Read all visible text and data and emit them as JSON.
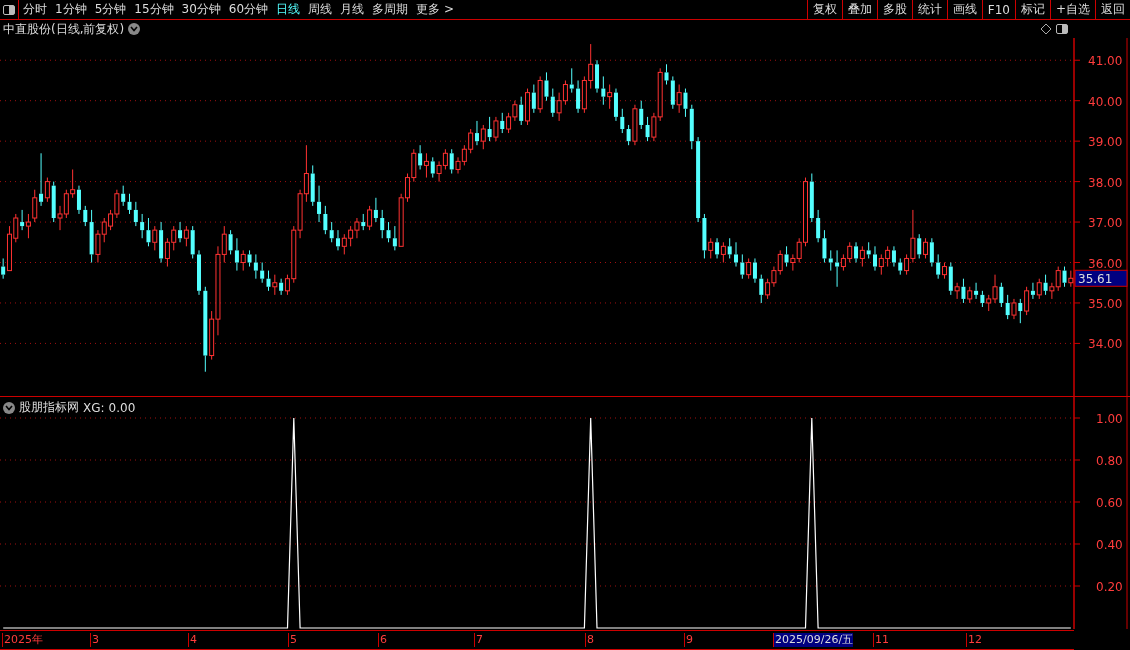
{
  "toolbar": {
    "periods": [
      {
        "label": "分时",
        "selected": false
      },
      {
        "label": "1分钟",
        "selected": false
      },
      {
        "label": "5分钟",
        "selected": false
      },
      {
        "label": "15分钟",
        "selected": false
      },
      {
        "label": "30分钟",
        "selected": false
      },
      {
        "label": "60分钟",
        "selected": false
      },
      {
        "label": "日线",
        "selected": true
      },
      {
        "label": "周线",
        "selected": false
      },
      {
        "label": "月线",
        "selected": false
      },
      {
        "label": "多周期",
        "selected": false
      },
      {
        "label": "更多 >",
        "selected": false
      }
    ],
    "buttons": [
      "复权",
      "叠加",
      "多股",
      "统计",
      "画线",
      "F10",
      "标记",
      "+自选",
      "返回"
    ]
  },
  "main_chart": {
    "title": "中直股份(日线,前复权)",
    "current_price": "35.61",
    "chart_data": {
      "type": "candlestick",
      "grid": true,
      "ylim": [
        32.7,
        41.55
      ],
      "yticks": [
        {
          "value": 41,
          "label": "41.00"
        },
        {
          "value": 40,
          "label": "40.00"
        },
        {
          "value": 39,
          "label": "39.00"
        },
        {
          "value": 38,
          "label": "38.00"
        },
        {
          "value": 37,
          "label": "37.00"
        },
        {
          "value": 36,
          "label": "36.00"
        },
        {
          "value": 35,
          "label": "35.00"
        },
        {
          "value": 34,
          "label": "34.00"
        }
      ],
      "ohlc": [
        [
          35.9,
          36.1,
          35.6,
          35.7
        ],
        [
          35.8,
          36.9,
          35.8,
          36.7
        ],
        [
          36.6,
          37.2,
          36.5,
          37.1
        ],
        [
          37.0,
          37.3,
          36.8,
          36.9
        ],
        [
          36.9,
          37.2,
          36.6,
          37.0
        ],
        [
          37.1,
          37.8,
          37.0,
          37.6
        ],
        [
          37.7,
          38.7,
          37.4,
          37.5
        ],
        [
          37.6,
          38.1,
          37.5,
          38.0
        ],
        [
          37.9,
          38.0,
          37.0,
          37.1
        ],
        [
          37.1,
          37.4,
          36.8,
          37.2
        ],
        [
          37.2,
          37.8,
          37.1,
          37.7
        ],
        [
          37.7,
          38.3,
          37.6,
          37.8
        ],
        [
          37.8,
          37.9,
          37.2,
          37.3
        ],
        [
          37.3,
          37.4,
          36.9,
          37.0
        ],
        [
          37.0,
          37.3,
          36.0,
          36.2
        ],
        [
          36.2,
          36.8,
          36.0,
          36.7
        ],
        [
          36.7,
          37.1,
          36.5,
          37.0
        ],
        [
          36.9,
          37.3,
          36.8,
          37.2
        ],
        [
          37.2,
          37.8,
          37.1,
          37.7
        ],
        [
          37.7,
          37.9,
          37.4,
          37.5
        ],
        [
          37.5,
          37.7,
          37.2,
          37.3
        ],
        [
          37.3,
          37.5,
          36.9,
          37.0
        ],
        [
          37.0,
          37.2,
          36.6,
          36.8
        ],
        [
          36.8,
          37.1,
          36.4,
          36.5
        ],
        [
          36.5,
          36.9,
          36.3,
          36.8
        ],
        [
          36.8,
          37.0,
          36.0,
          36.1
        ],
        [
          36.1,
          36.6,
          35.9,
          36.5
        ],
        [
          36.5,
          36.9,
          36.3,
          36.8
        ],
        [
          36.8,
          37.0,
          36.5,
          36.6
        ],
        [
          36.6,
          36.9,
          36.4,
          36.8
        ],
        [
          36.8,
          36.9,
          36.1,
          36.2
        ],
        [
          36.2,
          36.3,
          35.2,
          35.3
        ],
        [
          35.3,
          35.4,
          33.3,
          33.7
        ],
        [
          33.7,
          34.8,
          33.6,
          34.6
        ],
        [
          34.6,
          36.4,
          34.2,
          36.2
        ],
        [
          36.2,
          36.9,
          36.0,
          36.7
        ],
        [
          36.7,
          36.8,
          36.2,
          36.3
        ],
        [
          36.3,
          36.6,
          35.8,
          36.0
        ],
        [
          36.0,
          36.3,
          35.8,
          36.2
        ],
        [
          36.2,
          36.3,
          35.9,
          36.0
        ],
        [
          36.0,
          36.2,
          35.6,
          35.8
        ],
        [
          35.8,
          36.0,
          35.5,
          35.6
        ],
        [
          35.6,
          35.8,
          35.3,
          35.4
        ],
        [
          35.4,
          35.7,
          35.2,
          35.5
        ],
        [
          35.5,
          35.6,
          35.2,
          35.3
        ],
        [
          35.3,
          35.7,
          35.2,
          35.6
        ],
        [
          35.6,
          36.9,
          35.5,
          36.8
        ],
        [
          36.8,
          37.8,
          36.6,
          37.7
        ],
        [
          37.7,
          38.9,
          37.5,
          38.2
        ],
        [
          38.2,
          38.4,
          37.4,
          37.5
        ],
        [
          37.5,
          37.9,
          37.0,
          37.2
        ],
        [
          37.2,
          37.4,
          36.7,
          36.8
        ],
        [
          36.8,
          37.0,
          36.5,
          36.6
        ],
        [
          36.6,
          36.8,
          36.3,
          36.4
        ],
        [
          36.4,
          36.7,
          36.2,
          36.6
        ],
        [
          36.6,
          36.9,
          36.4,
          36.8
        ],
        [
          36.8,
          37.1,
          36.6,
          37.0
        ],
        [
          37.0,
          37.2,
          36.8,
          36.9
        ],
        [
          36.9,
          37.4,
          36.8,
          37.3
        ],
        [
          37.3,
          37.6,
          37.0,
          37.1
        ],
        [
          37.1,
          37.3,
          36.6,
          36.8
        ],
        [
          36.8,
          37.0,
          36.5,
          36.6
        ],
        [
          36.6,
          36.9,
          36.3,
          36.4
        ],
        [
          36.4,
          37.7,
          36.4,
          37.6
        ],
        [
          37.6,
          38.2,
          37.5,
          38.1
        ],
        [
          38.1,
          38.8,
          38.0,
          38.7
        ],
        [
          38.7,
          38.9,
          38.3,
          38.4
        ],
        [
          38.4,
          38.7,
          38.1,
          38.5
        ],
        [
          38.5,
          38.6,
          38.1,
          38.2
        ],
        [
          38.2,
          38.5,
          38.0,
          38.4
        ],
        [
          38.4,
          38.8,
          38.3,
          38.7
        ],
        [
          38.7,
          38.8,
          38.2,
          38.3
        ],
        [
          38.3,
          38.6,
          38.2,
          38.5
        ],
        [
          38.5,
          38.9,
          38.4,
          38.8
        ],
        [
          38.8,
          39.3,
          38.7,
          39.2
        ],
        [
          39.2,
          39.5,
          38.9,
          39.0
        ],
        [
          39.0,
          39.4,
          38.8,
          39.3
        ],
        [
          39.3,
          39.6,
          39.0,
          39.1
        ],
        [
          39.1,
          39.6,
          39.0,
          39.5
        ],
        [
          39.5,
          39.7,
          39.2,
          39.3
        ],
        [
          39.3,
          39.7,
          39.2,
          39.6
        ],
        [
          39.6,
          40.0,
          39.5,
          39.9
        ],
        [
          39.9,
          40.1,
          39.4,
          39.5
        ],
        [
          39.5,
          40.3,
          39.4,
          40.2
        ],
        [
          40.2,
          40.4,
          39.7,
          39.8
        ],
        [
          39.8,
          40.6,
          39.7,
          40.5
        ],
        [
          40.5,
          40.7,
          40.0,
          40.1
        ],
        [
          40.1,
          40.3,
          39.6,
          39.7
        ],
        [
          39.7,
          40.2,
          39.5,
          40.0
        ],
        [
          40.0,
          40.5,
          39.9,
          40.4
        ],
        [
          40.4,
          40.8,
          40.2,
          40.3
        ],
        [
          40.3,
          40.5,
          39.7,
          39.8
        ],
        [
          39.8,
          40.6,
          39.7,
          40.5
        ],
        [
          40.5,
          41.4,
          40.3,
          40.9
        ],
        [
          40.9,
          41.0,
          40.2,
          40.3
        ],
        [
          40.3,
          40.6,
          39.9,
          40.1
        ],
        [
          40.1,
          40.4,
          39.8,
          40.2
        ],
        [
          40.2,
          40.3,
          39.5,
          39.6
        ],
        [
          39.6,
          39.8,
          39.2,
          39.3
        ],
        [
          39.3,
          39.4,
          38.9,
          39.0
        ],
        [
          39.0,
          39.9,
          38.9,
          39.8
        ],
        [
          39.8,
          40.0,
          39.3,
          39.4
        ],
        [
          39.4,
          39.6,
          39.0,
          39.1
        ],
        [
          39.1,
          39.7,
          39.0,
          39.6
        ],
        [
          39.6,
          40.8,
          39.5,
          40.7
        ],
        [
          40.7,
          40.9,
          40.4,
          40.5
        ],
        [
          40.5,
          40.6,
          39.8,
          39.9
        ],
        [
          39.9,
          40.4,
          39.7,
          40.2
        ],
        [
          40.2,
          40.3,
          39.6,
          39.8
        ],
        [
          39.8,
          39.9,
          38.8,
          39.0
        ],
        [
          39.0,
          39.1,
          37.0,
          37.1
        ],
        [
          37.1,
          37.2,
          36.1,
          36.3
        ],
        [
          36.3,
          36.6,
          36.1,
          36.5
        ],
        [
          36.5,
          36.6,
          36.1,
          36.2
        ],
        [
          36.2,
          36.5,
          36.0,
          36.4
        ],
        [
          36.4,
          36.6,
          36.1,
          36.2
        ],
        [
          36.2,
          36.5,
          35.9,
          36.0
        ],
        [
          36.0,
          36.2,
          35.6,
          35.7
        ],
        [
          35.7,
          36.1,
          35.6,
          36.0
        ],
        [
          36.0,
          36.1,
          35.5,
          35.6
        ],
        [
          35.6,
          35.7,
          35.0,
          35.2
        ],
        [
          35.2,
          35.6,
          35.1,
          35.5
        ],
        [
          35.5,
          35.9,
          35.4,
          35.8
        ],
        [
          35.8,
          36.3,
          35.7,
          36.2
        ],
        [
          36.2,
          36.4,
          35.9,
          36.0
        ],
        [
          36.0,
          36.2,
          35.8,
          36.1
        ],
        [
          36.1,
          36.6,
          36.0,
          36.5
        ],
        [
          36.5,
          38.1,
          36.4,
          38.0
        ],
        [
          38.0,
          38.2,
          37.0,
          37.1
        ],
        [
          37.1,
          37.3,
          36.5,
          36.6
        ],
        [
          36.6,
          36.8,
          36.0,
          36.1
        ],
        [
          36.1,
          36.3,
          35.8,
          36.0
        ],
        [
          36.0,
          36.3,
          35.4,
          35.9
        ],
        [
          35.9,
          36.2,
          35.8,
          36.1
        ],
        [
          36.1,
          36.5,
          36.0,
          36.4
        ],
        [
          36.4,
          36.5,
          36.0,
          36.1
        ],
        [
          36.1,
          36.4,
          35.9,
          36.3
        ],
        [
          36.3,
          36.5,
          36.1,
          36.2
        ],
        [
          36.2,
          36.4,
          35.8,
          35.9
        ],
        [
          35.9,
          36.2,
          35.7,
          36.1
        ],
        [
          36.1,
          36.4,
          35.9,
          36.3
        ],
        [
          36.3,
          36.4,
          35.9,
          36.0
        ],
        [
          36.0,
          36.1,
          35.7,
          35.8
        ],
        [
          35.8,
          36.2,
          35.7,
          36.1
        ],
        [
          36.1,
          37.3,
          36.0,
          36.6
        ],
        [
          36.6,
          36.7,
          36.1,
          36.2
        ],
        [
          36.2,
          36.6,
          36.1,
          36.5
        ],
        [
          36.5,
          36.6,
          35.9,
          36.0
        ],
        [
          36.0,
          36.2,
          35.6,
          35.7
        ],
        [
          35.7,
          36.0,
          35.6,
          35.9
        ],
        [
          35.9,
          36.0,
          35.2,
          35.3
        ],
        [
          35.3,
          35.5,
          35.1,
          35.4
        ],
        [
          35.4,
          35.6,
          35.0,
          35.1
        ],
        [
          35.1,
          35.4,
          35.0,
          35.3
        ],
        [
          35.3,
          35.5,
          35.1,
          35.2
        ],
        [
          35.2,
          35.3,
          34.9,
          35.0
        ],
        [
          35.0,
          35.2,
          34.8,
          35.1
        ],
        [
          35.1,
          35.7,
          35.0,
          35.4
        ],
        [
          35.4,
          35.5,
          34.9,
          35.0
        ],
        [
          35.0,
          35.2,
          34.6,
          34.7
        ],
        [
          34.7,
          35.1,
          34.6,
          35.0
        ],
        [
          35.0,
          35.1,
          34.5,
          34.8
        ],
        [
          34.8,
          35.4,
          34.7,
          35.3
        ],
        [
          35.3,
          35.5,
          35.1,
          35.2
        ],
        [
          35.2,
          35.6,
          35.1,
          35.5
        ],
        [
          35.5,
          35.7,
          35.2,
          35.3
        ],
        [
          35.3,
          35.5,
          35.1,
          35.4
        ],
        [
          35.4,
          35.9,
          35.3,
          35.8
        ],
        [
          35.8,
          35.9,
          35.4,
          35.5
        ],
        [
          35.5,
          35.8,
          35.4,
          35.61
        ]
      ]
    }
  },
  "indicator": {
    "name": "股朋指标网",
    "reading": "0.00",
    "chart_data": {
      "type": "line",
      "grid": true,
      "ylim": [
        0,
        1
      ],
      "yticks": [
        {
          "value": 0.2,
          "label": "0.20"
        },
        {
          "value": 0.4,
          "label": "0.40"
        },
        {
          "value": 0.6,
          "label": "0.60"
        },
        {
          "value": 0.8,
          "label": "0.80"
        },
        {
          "value": 1,
          "label": "1.00"
        }
      ],
      "series": [
        {
          "name": "XG:",
          "color": "#ffffff",
          "values": [
            0,
            0,
            0,
            0,
            0,
            0,
            0,
            0,
            0,
            0,
            0,
            0,
            0,
            0,
            0,
            0,
            0,
            0,
            0,
            0,
            0,
            0,
            0,
            0,
            0,
            0,
            0,
            0,
            0,
            0,
            0,
            0,
            0,
            0,
            0,
            0,
            0,
            0,
            0,
            0,
            0,
            0,
            0,
            0,
            0,
            0,
            1,
            0,
            0,
            0,
            0,
            0,
            0,
            0,
            0,
            0,
            0,
            0,
            0,
            0,
            0,
            0,
            0,
            0,
            0,
            0,
            0,
            0,
            0,
            0,
            0,
            0,
            0,
            0,
            0,
            0,
            0,
            0,
            0,
            0,
            0,
            0,
            0,
            0,
            0,
            0,
            0,
            0,
            0,
            0,
            0,
            0,
            0,
            1,
            0,
            0,
            0,
            0,
            0,
            0,
            0,
            0,
            0,
            0,
            0,
            0,
            0,
            0,
            0,
            0,
            0,
            0,
            0,
            0,
            0,
            0,
            0,
            0,
            0,
            0,
            0,
            0,
            0,
            0,
            0,
            0,
            0,
            0,
            1,
            0,
            0,
            0,
            0,
            0,
            0,
            0,
            0,
            0,
            0,
            0,
            0,
            0,
            0,
            0,
            0,
            0,
            0,
            0,
            0,
            0,
            0,
            0,
            0,
            0,
            0,
            0,
            0,
            0,
            0,
            0,
            0,
            0,
            0,
            0,
            0,
            0,
            0,
            0,
            0,
            0
          ]
        }
      ]
    }
  },
  "date_axis": [
    {
      "label": "2025年",
      "selected": false
    },
    {
      "label": "3",
      "selected": false
    },
    {
      "label": "4",
      "selected": false
    },
    {
      "label": "5",
      "selected": false
    },
    {
      "label": "6",
      "selected": false
    },
    {
      "label": "7",
      "selected": false
    },
    {
      "label": "8",
      "selected": false
    },
    {
      "label": "9",
      "selected": false
    },
    {
      "label": "2025/09/26/五",
      "selected": true
    },
    {
      "label": "11",
      "selected": false
    },
    {
      "label": "12",
      "selected": false
    }
  ]
}
